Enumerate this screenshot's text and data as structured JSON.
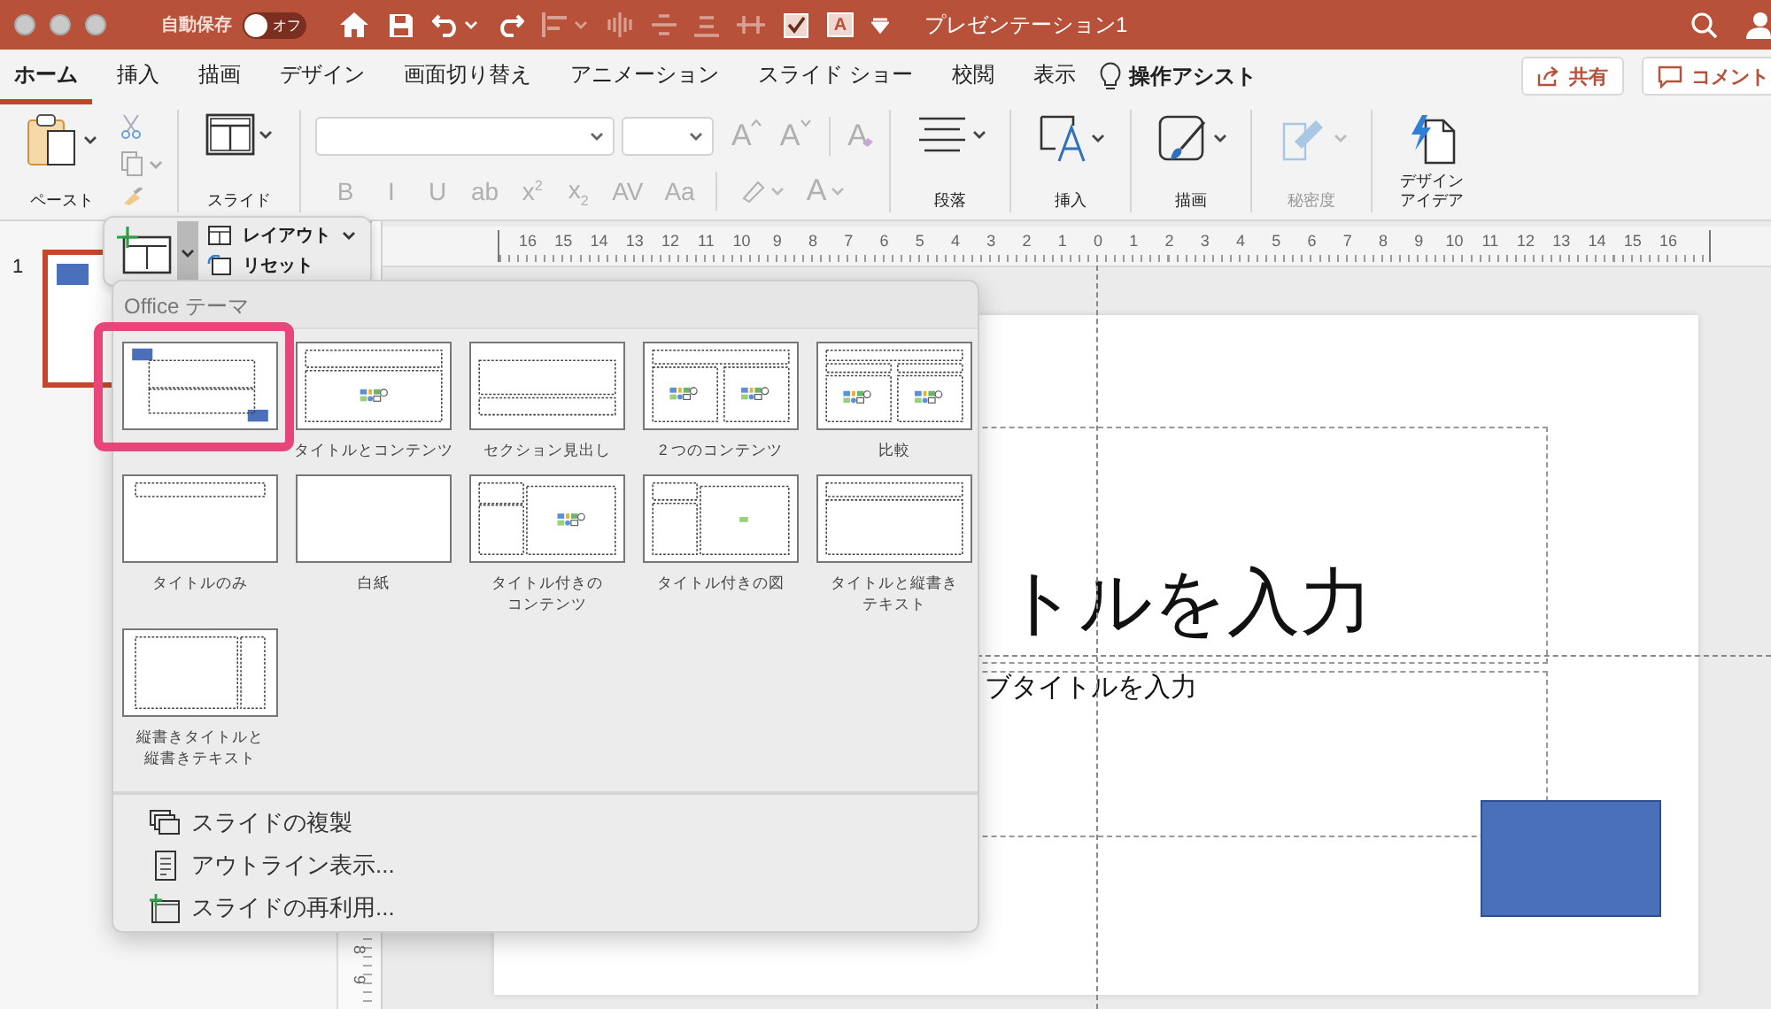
{
  "title_bar": {
    "autosave_label": "自動保存",
    "autosave": {
      "label": "オフ",
      "on": false
    },
    "textbox_icon_label": "A",
    "title": "プレゼンテーション1"
  },
  "tabs": [
    {
      "label": "ホーム",
      "selected": true
    },
    {
      "label": "挿入",
      "selected": false
    },
    {
      "label": "描画",
      "selected": false
    },
    {
      "label": "デザイン",
      "selected": false
    },
    {
      "label": "画面切り替え",
      "selected": false
    },
    {
      "label": "アニメーション",
      "selected": false
    },
    {
      "label": "スライド ショー",
      "selected": false
    },
    {
      "label": "校閲",
      "selected": false
    },
    {
      "label": "表示",
      "selected": false
    }
  ],
  "assist": "操作アシスト",
  "share_button": "共有",
  "comment_button": "コメント",
  "ribbon": {
    "paste": "ペースト",
    "slide": "スライド",
    "font_disabled": true,
    "font_tools": [
      {
        "kind": "grow",
        "label": "A"
      },
      {
        "kind": "shrink",
        "label": "A"
      }
    ],
    "clear_format": "A",
    "format_buttons": [
      "B",
      "I",
      "U",
      "ab",
      "x$^{2}$",
      "x$_{2}$",
      "AV",
      "Aa"
    ],
    "font_color": "A",
    "groups": [
      {
        "kind": "paragraph",
        "label": "段落",
        "disabled": false
      },
      {
        "kind": "insert",
        "label": "挿入",
        "disabled": false
      },
      {
        "kind": "draw",
        "label": "描画",
        "disabled": false
      },
      {
        "kind": "sensitivity",
        "label": "秘密度",
        "disabled": true
      },
      {
        "kind": "designer",
        "label": [
          "デザイン",
          "アイデア"
        ],
        "disabled": false
      }
    ]
  },
  "thumbnail_pane": {
    "slide_number": "1",
    "selected": true
  },
  "ruler": {
    "horizontal": [
      "16",
      "15",
      "14",
      "13",
      "12",
      "11",
      "10",
      "9",
      "8",
      "7",
      "6",
      "5",
      "4",
      "3",
      "2",
      "1",
      "0",
      "1",
      "2",
      "3",
      "4",
      "5",
      "6",
      "7",
      "8",
      "9",
      "10",
      "11",
      "12",
      "13",
      "14",
      "15",
      "16"
    ],
    "vertical": [
      "8",
      "9"
    ]
  },
  "slide": {
    "title": "トルを入力",
    "subtitle": "ブタイトルを入力"
  },
  "slide_popup": {
    "layout": "レイアウト",
    "reset": "リセット"
  },
  "gallery": {
    "header": "Office テーマ",
    "layouts": [
      {
        "kind": "title",
        "selected": true
      },
      {
        "kind": "title_content",
        "label": [
          "タイトルとコンテンツ"
        ],
        "selected": false
      },
      {
        "kind": "section",
        "label": [
          "セクション見出し"
        ],
        "selected": false
      },
      {
        "kind": "two_content",
        "label": [
          "2 つのコンテンツ"
        ],
        "selected": false
      },
      {
        "kind": "comparison",
        "label": [
          "比較"
        ],
        "selected": false
      },
      {
        "kind": "title_only",
        "label": [
          "タイトルのみ"
        ],
        "selected": false
      },
      {
        "kind": "blank",
        "label": [
          "白紙"
        ],
        "selected": false
      },
      {
        "kind": "content_caption",
        "label": [
          "タイトル付きの",
          "コンテンツ"
        ],
        "selected": false
      },
      {
        "kind": "picture_caption",
        "label": [
          "タイトル付きの図"
        ],
        "selected": false
      },
      {
        "kind": "vertical_text",
        "label": [
          "タイトルと縦書き",
          "テキスト"
        ],
        "selected": false
      },
      {
        "kind": "vertical_title_text",
        "label": [
          "縦書きタイトルと",
          "縦書きテキスト"
        ],
        "selected": false
      }
    ],
    "actions": [
      {
        "kind": "duplicate",
        "label": "スライドの複製"
      },
      {
        "kind": "outline",
        "label": "アウトライン表示..."
      },
      {
        "kind": "reuse",
        "label": "スライドの再利用..."
      }
    ]
  }
}
